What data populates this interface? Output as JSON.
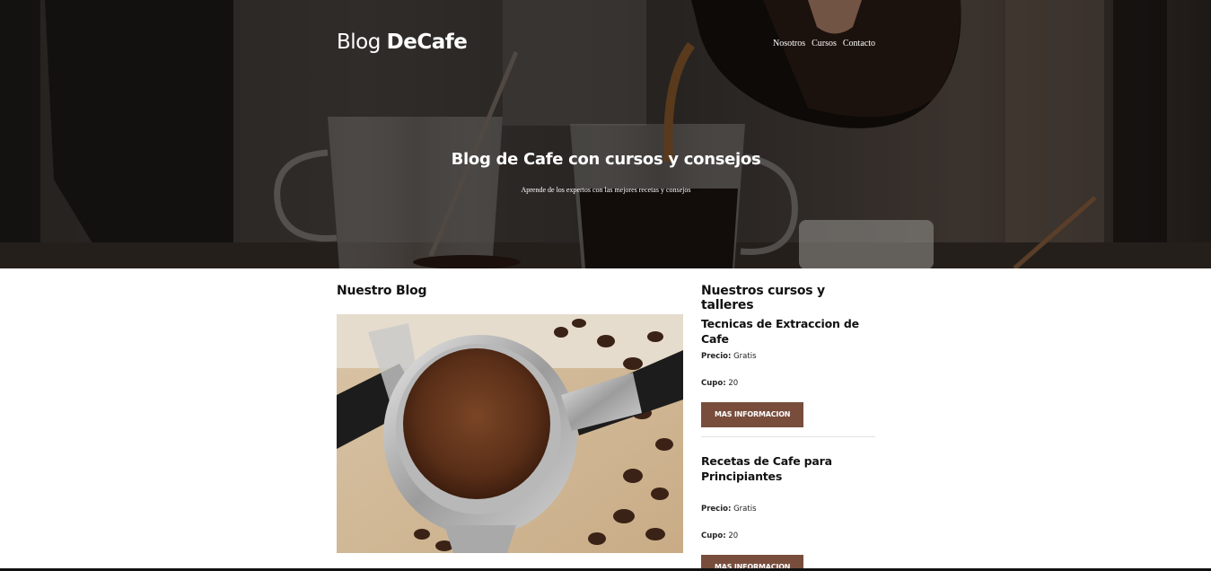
{
  "header": {
    "logo_light": "Blog ",
    "logo_bold": "DeCafe",
    "nav": [
      "Nosotros",
      "Cursos",
      "Contacto"
    ]
  },
  "hero": {
    "title": "Blog de Cafe con cursos y consejos",
    "subtitle": "Aprende de los expertos con las mejores recetas y consejos"
  },
  "blog": {
    "title": "Nuestro Blog"
  },
  "courses": {
    "title": "Nuestros cursos y talleres",
    "items": [
      {
        "title": "Tecnicas de Extraccion de Cafe",
        "price_label": "Precio:",
        "price": "Gratis",
        "seats_label": "Cupo:",
        "seats": "20",
        "button": "MAS INFORMACION"
      },
      {
        "title": "Recetas de Cafe para Principiantes",
        "price_label": "Precio:",
        "price": "Gratis",
        "seats_label": "Cupo:",
        "seats": "20",
        "button": "MAS INFORMACION"
      }
    ]
  },
  "colors": {
    "accent": "#784D3C",
    "text": "#111111"
  }
}
